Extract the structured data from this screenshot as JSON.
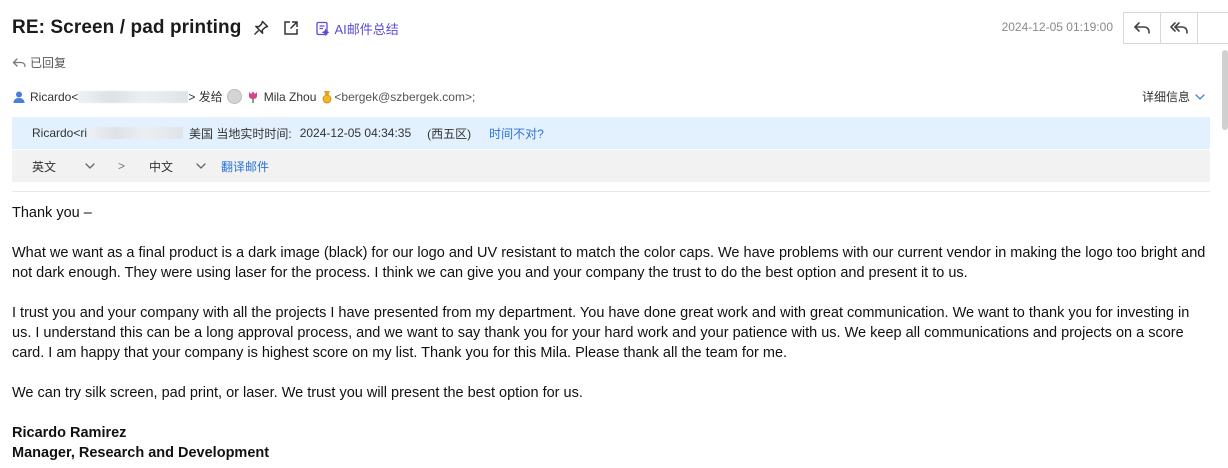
{
  "header": {
    "subject": "RE: Screen / pad printing",
    "ai_label": "AI邮件总结",
    "date": "2024-12-05 01:19:00",
    "replied_label": "已回复"
  },
  "from": {
    "sender_name": "Ricardo<",
    "sender_close": "> 发给",
    "recipient_name": "Mila Zhou",
    "recipient_email": "<bergek@szbergek.com>;",
    "detail_label": "详细信息"
  },
  "timezone": {
    "sender_prefix": "Ricardo<ri",
    "country": "美国 当地实时时间:",
    "local_time": "2024-12-05 04:34:35",
    "zone": "(西五区)",
    "wrong_time_link": "时间不对?"
  },
  "translate": {
    "source_lang": "英文",
    "arrow": ">",
    "target_lang": "中文",
    "translate_link": "翻译邮件"
  },
  "body": {
    "greeting": "Thank you –",
    "paragraphs": [
      "What we want as a final product is a dark image (black) for our logo and UV resistant to match the color caps. We have problems with our current vendor in making the logo too bright and not dark enough. They were using laser for the process. I think we can give you and your company the trust to do the best option and present it to us.",
      "I trust you and your company with all the projects I have presented from my department. You have done great work and with great communication. We want to thank you for investing in us. I understand this can be a long approval process, and we want to say thank you for your hard work and your patience with us. We keep all communications and projects on a score card. I am happy that your company is highest score on my list. Thank you for this Mila. Please thank all the team for me.",
      "We can try silk screen, pad print, or laser. We trust you will present the best option for us."
    ],
    "signature_name": "Ricardo Ramirez",
    "signature_title": "Manager, Research and Development"
  },
  "colors": {
    "accent": "#5b4bd6",
    "link": "#2b73d8",
    "timezone_bg": "#e3f0fd",
    "translate_bg": "#f2f2f2"
  },
  "icons": [
    "pin-icon",
    "open-external-icon",
    "ai-summary-icon",
    "reply-icon",
    "reply-all-icon",
    "replied-icon",
    "user-icon",
    "badge-icon",
    "chevron-down-icon"
  ]
}
